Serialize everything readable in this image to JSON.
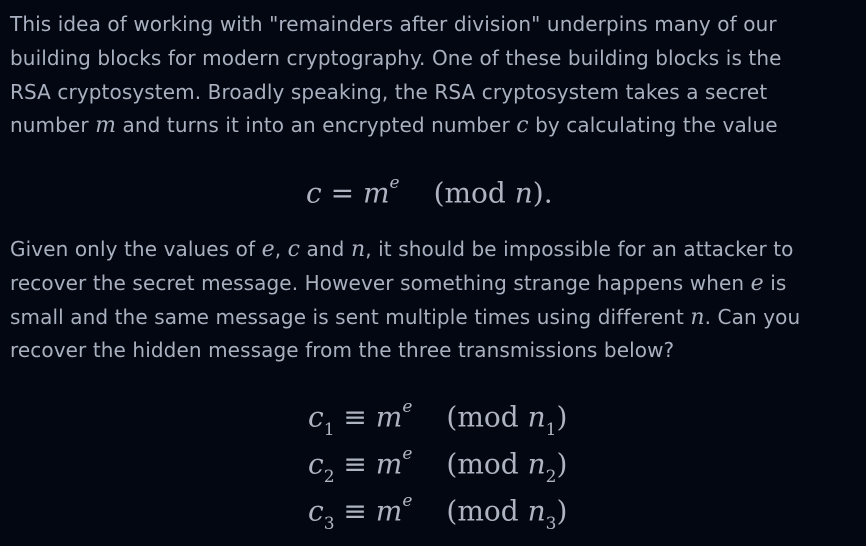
{
  "paragraph1": {
    "t1": "This idea of working with \"remainders after division\" underpins many of our",
    "t2": "building blocks for modern cryptography. One of these building blocks is the",
    "t3": "RSA cryptosystem. Broadly speaking, the RSA cryptosystem takes a secret",
    "t4a": "number ",
    "var_m": "m",
    "t4b": " and turns it into an encrypted number ",
    "var_c": "c",
    "t4c": " by calculating the value"
  },
  "equation_main": {
    "lhs": "c",
    "eq": " = ",
    "base": "m",
    "exp": "e",
    "mod": "(mod ",
    "n": "n",
    "close": ")."
  },
  "paragraph2": {
    "t1a": "Given only the values of ",
    "var_e1": "e",
    "t1b": ", ",
    "var_c": "c",
    "t1c": " and ",
    "var_n": "n",
    "t1d": ", it should be impossible for an attacker to",
    "t2a": "recover the secret message. However something strange happens when ",
    "var_e2": "e",
    "t2b": " is",
    "t3a": "small and the same message is sent multiple times using different ",
    "var_n2": "n",
    "t3b": ". Can you",
    "t4": "recover the hidden message from the three transmissions below?"
  },
  "system": [
    {
      "c": "c",
      "sub": "1",
      "equiv": " ≡ ",
      "m": "m",
      "e": "e",
      "mod": "(mod ",
      "n": "n",
      "nsub": "1",
      "close": ")"
    },
    {
      "c": "c",
      "sub": "2",
      "equiv": " ≡ ",
      "m": "m",
      "e": "e",
      "mod": "(mod ",
      "n": "n",
      "nsub": "2",
      "close": ")"
    },
    {
      "c": "c",
      "sub": "3",
      "equiv": " ≡ ",
      "m": "m",
      "e": "e",
      "mod": "(mod ",
      "n": "n",
      "nsub": "3",
      "close": ")"
    }
  ]
}
